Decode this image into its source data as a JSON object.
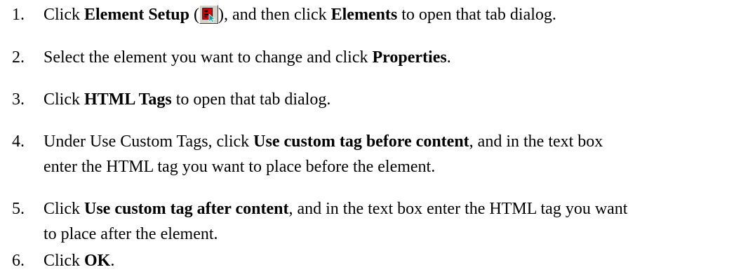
{
  "steps": [
    {
      "number": "1.",
      "pre": "Click ",
      "bold1": "Element Setup",
      "mid1": " (",
      "icon": "element-setup-icon",
      "mid2": "), and then click ",
      "bold2": "Elements",
      "post": " to open that tab dialog."
    },
    {
      "number": "2.",
      "pre": "Select the element you want to change and click ",
      "bold1": "Properties",
      "post": "."
    },
    {
      "number": "3.",
      "pre": "Click ",
      "bold1": "HTML Tags",
      "post": " to open that tab dialog."
    },
    {
      "number": "4.",
      "pre": "Under Use Custom Tags, click ",
      "bold1": "Use custom tag before content",
      "post": ", and in the text box",
      "line2": "enter the HTML tag you want to place before the element."
    },
    {
      "number": "5.",
      "pre": "Click ",
      "bold1": "Use custom tag after content",
      "post": ", and in the text box enter the HTML tag you want",
      "line2": "to place after the element."
    },
    {
      "number": "6.",
      "pre": "Click ",
      "bold1": "OK",
      "post": "."
    }
  ],
  "colors": {
    "text": "#000000",
    "icon_red": "#e00000",
    "icon_cursor": "#00a8a8"
  }
}
